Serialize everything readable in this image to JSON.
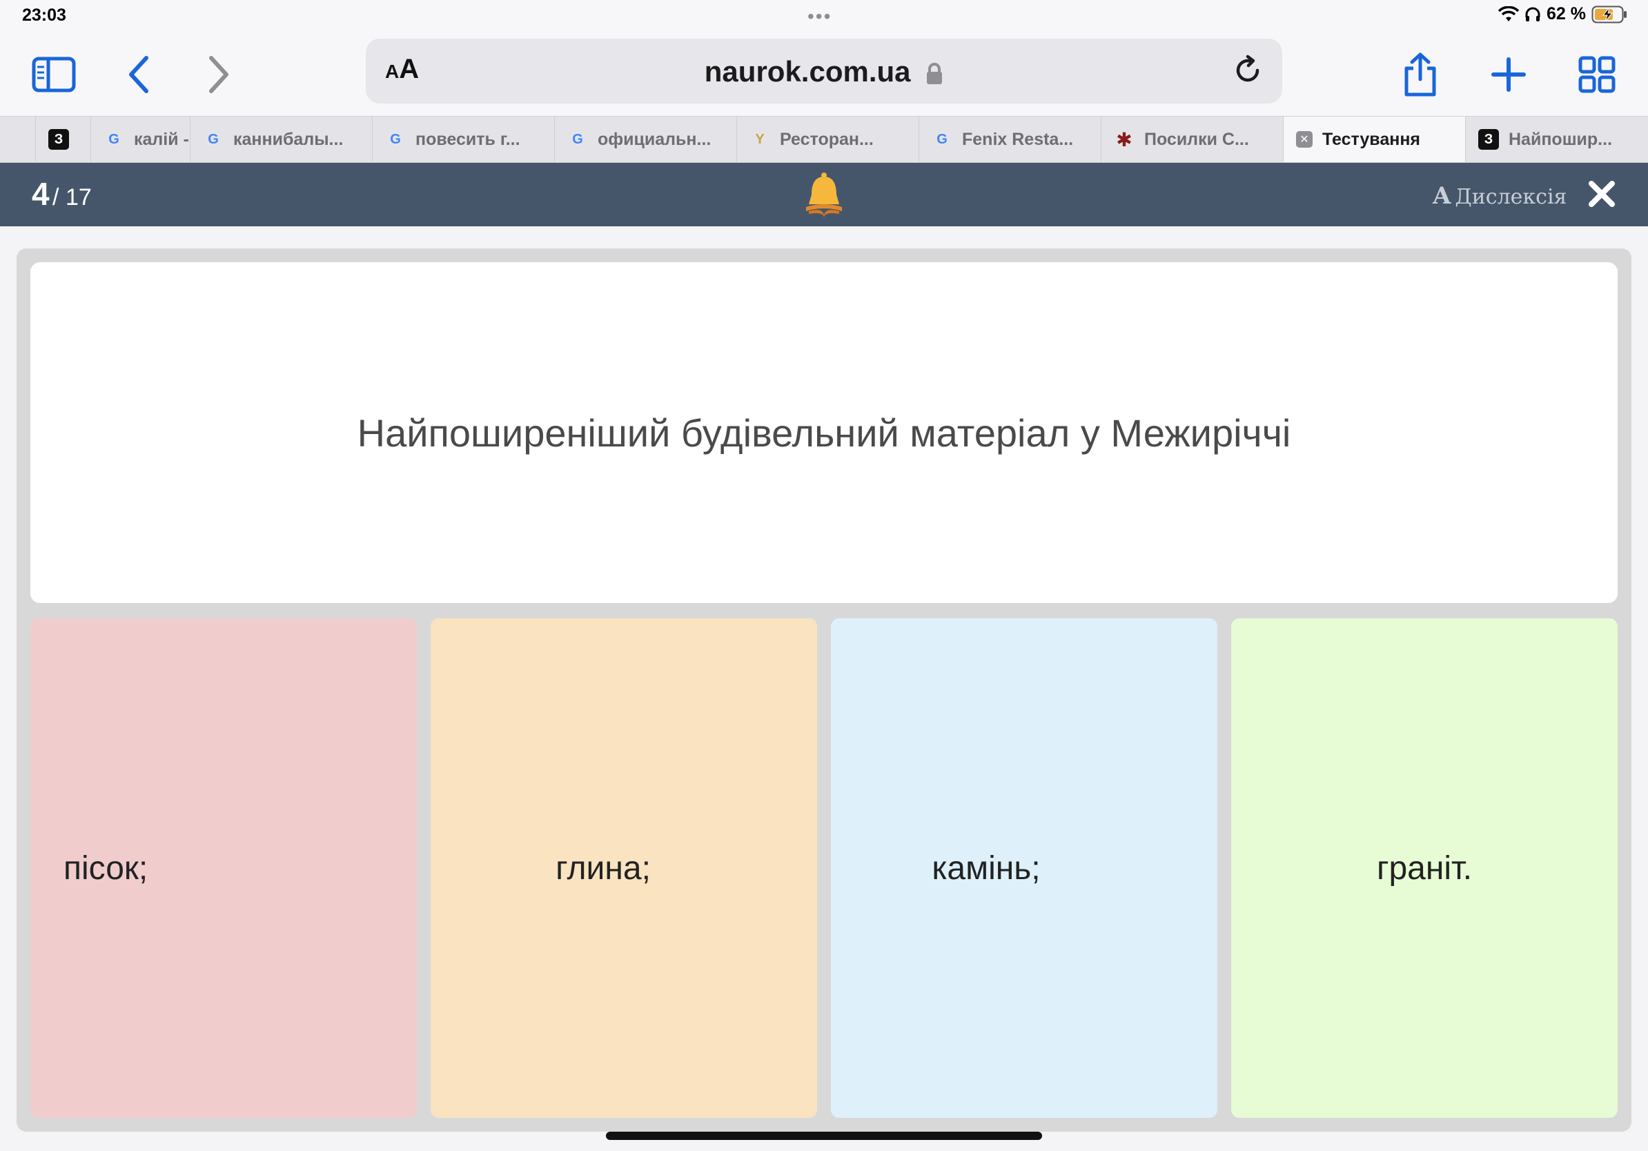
{
  "status": {
    "time": "23:03",
    "battery": "62 %",
    "icons": [
      "wifi-icon",
      "headphones-icon",
      "battery-charging-icon"
    ]
  },
  "toolbar": {
    "url": "naurok.com.ua",
    "aa": "AA",
    "icons": [
      "sidebar-icon",
      "back-icon",
      "forward-icon",
      "reload-icon",
      "share-icon",
      "new-tab-icon",
      "tabs-overview-icon"
    ]
  },
  "tabs": [
    {
      "label": "",
      "favicon": "З"
    },
    {
      "label": "калій -",
      "favicon": "G"
    },
    {
      "label": "каннибалы...",
      "favicon": "G"
    },
    {
      "label": "повесить г...",
      "favicon": "G"
    },
    {
      "label": "официальн...",
      "favicon": "G"
    },
    {
      "label": "Ресторан...",
      "favicon": "Y"
    },
    {
      "label": "Fenix Resta...",
      "favicon": "G"
    },
    {
      "label": "Посилки С...",
      "favicon": "✱"
    },
    {
      "label": "Тестування",
      "favicon": "✕",
      "active": true
    },
    {
      "label": "Найпошир...",
      "favicon": "З"
    }
  ],
  "quiz": {
    "current": "4",
    "total": "/ 17",
    "dyslexia_label": "Дислексія",
    "dyslexia_glyph": "A",
    "question": "Найпоширеніший будівельний матеріал у Межиріччі",
    "answers": [
      "пісок;",
      "глина;",
      "камінь;",
      "граніт."
    ]
  },
  "colors": {
    "header": "#46566a",
    "accent_blue": "#1a66d9",
    "answer_1": "#f0cccd",
    "answer_2": "#f9e3c0",
    "answer_3": "#def1fa",
    "answer_4": "#e7fbd4"
  }
}
